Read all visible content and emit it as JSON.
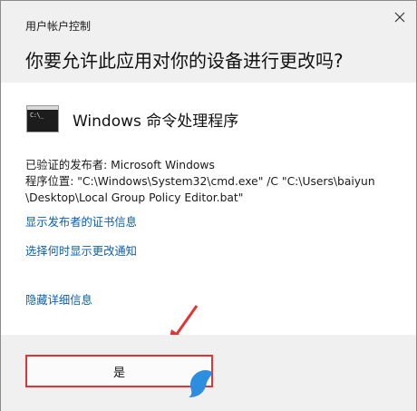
{
  "window": {
    "title": "用户帐户控制",
    "close_label": "×"
  },
  "question": "你要允许此应用对你的设备进行更改吗?",
  "app": {
    "icon_name": "cmd-icon",
    "prompt_text": "C:\\_",
    "name": "Windows 命令处理程序"
  },
  "details": {
    "publisher": "已验证的发布者: Microsoft Windows",
    "location_line1": "程序位置: \"C:\\Windows\\System32\\cmd.exe\" /C \"C:\\Users\\baiyun",
    "location_line2": "\\Desktop\\Local Group Policy Editor.bat\""
  },
  "links": {
    "show_cert": "显示发布者的证书信息",
    "change_notify": "选择何时显示更改通知",
    "hide_details": "隐藏详细信息"
  },
  "buttons": {
    "yes": "是"
  },
  "colors": {
    "link": "#0a5fb4",
    "highlight": "#e23434",
    "header_bg": "#f0f0f0"
  }
}
